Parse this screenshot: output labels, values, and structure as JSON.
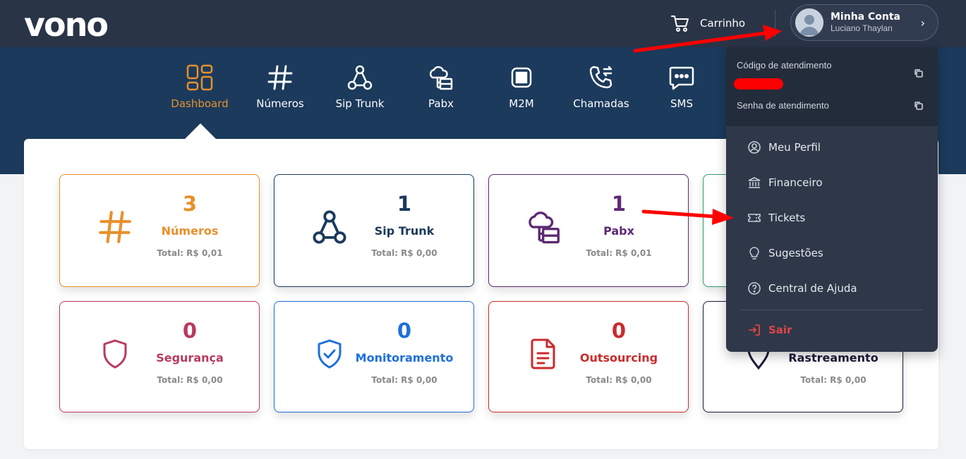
{
  "header": {
    "logo": "vono",
    "cart_label": "Carrinho",
    "account_title": "Minha Conta",
    "account_name": "Luciano Thaylan"
  },
  "nav": {
    "items": [
      {
        "label": "Dashboard",
        "icon": "grid-icon",
        "active": true
      },
      {
        "label": "Números",
        "icon": "hash-icon"
      },
      {
        "label": "Sip Trunk",
        "icon": "sip-trunk-icon"
      },
      {
        "label": "Pabx",
        "icon": "pabx-icon"
      },
      {
        "label": "M2M",
        "icon": "sim-card-icon"
      },
      {
        "label": "Chamadas",
        "icon": "phone-transfer-icon"
      },
      {
        "label": "SMS",
        "icon": "sms-chat-icon"
      }
    ]
  },
  "cards": [
    {
      "count": "3",
      "label": "Números",
      "total": "Total: R$ 0,01",
      "icon": "hash-icon",
      "color": "#e8902c"
    },
    {
      "count": "1",
      "label": "Sip Trunk",
      "total": "Total: R$ 0,00",
      "icon": "sip-trunk-icon",
      "color": "#1b3a5c"
    },
    {
      "count": "1",
      "label": "Pabx",
      "total": "Total: R$ 0,01",
      "icon": "pabx-icon",
      "color": "#5d2a73"
    },
    {
      "icon": "",
      "color": "#2f9e6a"
    },
    {
      "count": "0",
      "label": "Segurança",
      "total": "Total: R$ 0,00",
      "icon": "shield-icon",
      "color": "#b83a5c"
    },
    {
      "count": "0",
      "label": "Monitoramento",
      "total": "Total: R$ 0,00",
      "icon": "shield-check-icon",
      "color": "#1e6fd9"
    },
    {
      "count": "0",
      "label": "Outsourcing",
      "total": "Total: R$ 0,00",
      "icon": "document-icon",
      "color": "#cc2b2b"
    },
    {
      "label": "Rastreamento",
      "total": "Total: R$ 0,00",
      "icon": "location-pin-icon",
      "color": "#1d1a3a"
    }
  ],
  "dropdown": {
    "code_label": "Código de atendimento",
    "password_label": "Senha de atendimento",
    "items": [
      {
        "label": "Meu Perfil",
        "icon": "user-circle-icon"
      },
      {
        "label": "Financeiro",
        "icon": "bank-icon"
      },
      {
        "label": "Tickets",
        "icon": "ticket-icon"
      },
      {
        "label": "Sugestões",
        "icon": "lightbulb-icon"
      },
      {
        "label": "Central de Ajuda",
        "icon": "help-circle-icon"
      }
    ],
    "logout_label": "Sair"
  },
  "colors": {
    "topbar": "#2a3447",
    "navband": "#1b3a5c",
    "accent": "#e8902c",
    "dropdown": "#2e3849",
    "annotation_arrow": "#ff0000"
  }
}
